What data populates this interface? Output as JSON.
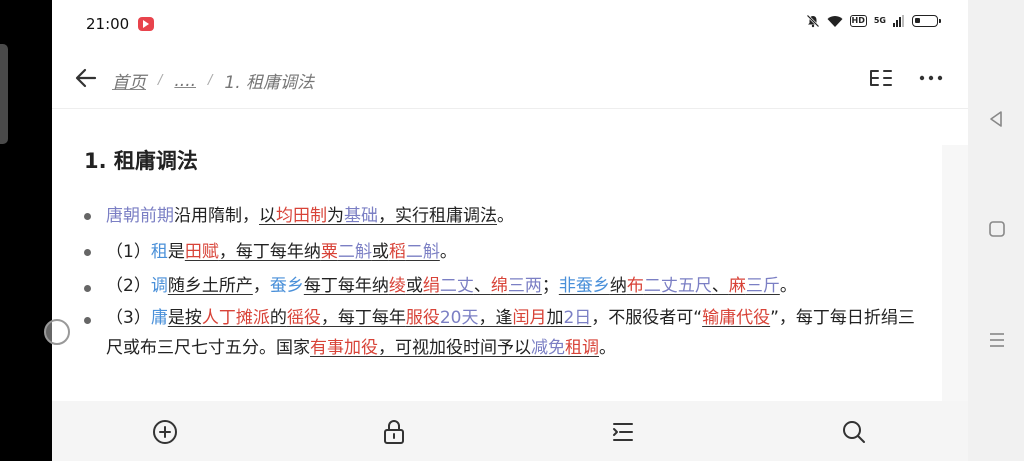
{
  "status": {
    "time": "21:00",
    "hd": "HD",
    "network": "5G"
  },
  "breadcrumb": {
    "home": "首页",
    "ellipsis": "....",
    "sep": "/",
    "current": "1. 租庸调法"
  },
  "content": {
    "title": "1. 租庸调法",
    "b1": {
      "s0": "唐朝前期",
      "s1": "沿用隋制，",
      "s2": "以",
      "s3": "均田制",
      "s4": "为",
      "s5": "基础",
      "s6": "，实行租庸调法",
      "s7": "。"
    },
    "b2": {
      "s0": "（1）",
      "s1": "租",
      "s2": "是",
      "s3": "田赋",
      "s4": "，每丁每年纳",
      "s5": "粟",
      "s6": "二斛",
      "s7": "或",
      "s8": "稻",
      "s9": "二斛",
      "s10": "。"
    },
    "b3": {
      "s0": "（2）",
      "s1": "调",
      "s2": "随乡土所产",
      "s3": "，",
      "s4": "蚕乡",
      "s5": "每丁每年纳",
      "s6": "绫",
      "s7": "或",
      "s8": "绢",
      "s9": "二丈",
      "s10": "、",
      "s11": "绵",
      "s12": "三两",
      "s13": "；",
      "s14": "非蚕乡",
      "s15": "纳",
      "s16": "布",
      "s17": "二丈五尺",
      "s18": "、",
      "s19": "麻",
      "s20": "三斤",
      "s21": "。"
    },
    "b4": {
      "s0": "（3）",
      "s1": "庸",
      "s2": "是按",
      "s3": "人丁摊派",
      "s4": "的",
      "s5": "徭役",
      "s6": "，每丁每年",
      "s7": "服役",
      "s8": "20天",
      "s9": "，逢",
      "s10": "闰月",
      "s11": "加",
      "s12": "2日",
      "s13": "，不服役者可“",
      "s14": "输庸代役",
      "s15": "”，",
      "s16": "每丁每日折绢三尺或布三尺七寸五分。国家",
      "s17": "有事加役",
      "s18": "，可视加役时间予以",
      "s19": "减免",
      "s20": "租调",
      "s21": "。"
    }
  },
  "icons": {
    "add": "add-circle-icon",
    "lock": "lock-icon",
    "toc": "toc-icon",
    "search": "search-icon",
    "more": "more-icon",
    "outline": "outline-icon"
  }
}
